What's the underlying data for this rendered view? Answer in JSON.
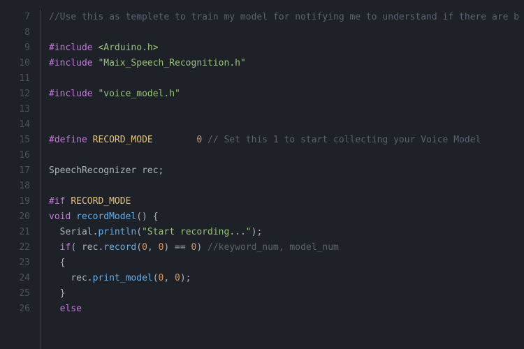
{
  "editor": {
    "first_line_number": 7,
    "lines": [
      [
        [
          "comment",
          "//Use this as templete to train my model for notifying me to understand if there are b"
        ]
      ],
      [],
      [
        [
          "preproc",
          "#include "
        ],
        [
          "header",
          "<Arduino.h>"
        ]
      ],
      [
        [
          "preproc",
          "#include "
        ],
        [
          "string",
          "\"Maix_Speech_Recognition.h\""
        ]
      ],
      [],
      [
        [
          "preproc",
          "#include "
        ],
        [
          "string",
          "\"voice_model.h\""
        ]
      ],
      [],
      [],
      [
        [
          "preproc",
          "#define "
        ],
        [
          "define",
          "RECORD_MODE        "
        ],
        [
          "number",
          "0"
        ],
        [
          "punct",
          " "
        ],
        [
          "comment",
          "// Set this 1 to start collecting your Voice Model"
        ]
      ],
      [],
      [
        [
          "type",
          "SpeechRecognizer "
        ],
        [
          "ident",
          "rec"
        ],
        [
          "punct",
          ";"
        ]
      ],
      [],
      [
        [
          "preproc",
          "#if "
        ],
        [
          "define",
          "RECORD_MODE"
        ]
      ],
      [
        [
          "keyword",
          "void "
        ],
        [
          "funcname",
          "recordModel"
        ],
        [
          "punct",
          "() {"
        ]
      ],
      [
        [
          "punct",
          "  "
        ],
        [
          "ident",
          "Serial"
        ],
        [
          "punct",
          "."
        ],
        [
          "funcname",
          "println"
        ],
        [
          "punct",
          "("
        ],
        [
          "string",
          "\"Start recording...\""
        ],
        [
          "punct",
          ");"
        ]
      ],
      [
        [
          "punct",
          "  "
        ],
        [
          "keyword",
          "if"
        ],
        [
          "punct",
          "( "
        ],
        [
          "ident",
          "rec"
        ],
        [
          "punct",
          "."
        ],
        [
          "funcname",
          "record"
        ],
        [
          "punct",
          "("
        ],
        [
          "number",
          "0"
        ],
        [
          "punct",
          ", "
        ],
        [
          "number",
          "0"
        ],
        [
          "punct",
          ") == "
        ],
        [
          "number",
          "0"
        ],
        [
          "punct",
          ") "
        ],
        [
          "comment",
          "//keyword_num, model_num"
        ]
      ],
      [
        [
          "punct",
          "  {"
        ]
      ],
      [
        [
          "punct",
          "    "
        ],
        [
          "ident",
          "rec"
        ],
        [
          "punct",
          "."
        ],
        [
          "funcname",
          "print_model"
        ],
        [
          "punct",
          "("
        ],
        [
          "number",
          "0"
        ],
        [
          "punct",
          ", "
        ],
        [
          "number",
          "0"
        ],
        [
          "punct",
          ");"
        ]
      ],
      [
        [
          "punct",
          "  }"
        ]
      ],
      [
        [
          "punct",
          "  "
        ],
        [
          "keyword",
          "else"
        ]
      ]
    ]
  }
}
